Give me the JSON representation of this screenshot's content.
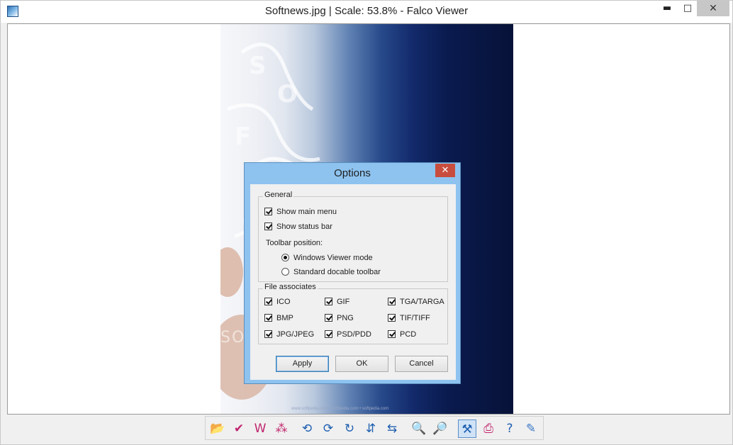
{
  "window": {
    "title": "Softnews.jpg | Scale: 53.8% - Falco Viewer",
    "controls": {
      "minimize": "▬",
      "maximize": "□",
      "close": "✕"
    }
  },
  "image": {
    "watermark": "SOFTPEDIA",
    "watermark_url": "www.softpedia.com",
    "footer_text": "www.softpedia.com • softpedia.com • softpedia.com"
  },
  "dialog": {
    "title": "Options",
    "close": "✕",
    "general": {
      "legend": "General",
      "show_main_menu": "Show main menu",
      "show_status_bar": "Show status bar",
      "toolbar_position_label": "Toolbar position:",
      "radio_windows_viewer": "Windows Viewer mode",
      "radio_standard_docable": "Standard docable toolbar",
      "selected_radio": "Windows Viewer mode"
    },
    "files": {
      "legend": "File associates",
      "items": [
        "ICO",
        "GIF",
        "TGA/TARGA",
        "BMP",
        "PNG",
        "TIF/TIFF",
        "JPG/JPEG",
        "PSD/PDD",
        "PCD"
      ]
    },
    "buttons": {
      "apply": "Apply",
      "ok": "OK",
      "cancel": "Cancel"
    }
  },
  "toolbar": {
    "tools": [
      {
        "name": "open-folder-icon",
        "glyph": "📂",
        "color": "#3a78c8"
      },
      {
        "name": "save-icon",
        "glyph": "✔",
        "color": "#c0266e"
      },
      {
        "name": "save-as-icon",
        "glyph": "W",
        "color": "#c0266e"
      },
      {
        "name": "batch-convert-icon",
        "glyph": "⁂",
        "color": "#c0266e"
      },
      {
        "name": "rotate-left-icon",
        "glyph": "⟲",
        "color": "#1e5fb0"
      },
      {
        "name": "rotate-right-icon",
        "glyph": "⟳",
        "color": "#1e5fb0"
      },
      {
        "name": "rotate-180-icon",
        "glyph": "↻",
        "color": "#1e5fb0"
      },
      {
        "name": "flip-vertical-icon",
        "glyph": "⇵",
        "color": "#1e5fb0"
      },
      {
        "name": "flip-horizontal-icon",
        "glyph": "⇆",
        "color": "#1e5fb0"
      },
      {
        "name": "zoom-in-icon",
        "glyph": "🔍",
        "color": "#1e5fb0"
      },
      {
        "name": "zoom-out-icon",
        "glyph": "🔎",
        "color": "#1e5fb0"
      },
      {
        "name": "options-icon",
        "glyph": "⚒",
        "color": "#1e5fb0"
      },
      {
        "name": "print-icon",
        "glyph": "⎙",
        "color": "#c0266e"
      },
      {
        "name": "help-icon",
        "glyph": "?",
        "color": "#1e5fb0"
      },
      {
        "name": "about-icon",
        "glyph": "✎",
        "color": "#3a78c8"
      }
    ],
    "pressed_tool": "options-icon"
  }
}
